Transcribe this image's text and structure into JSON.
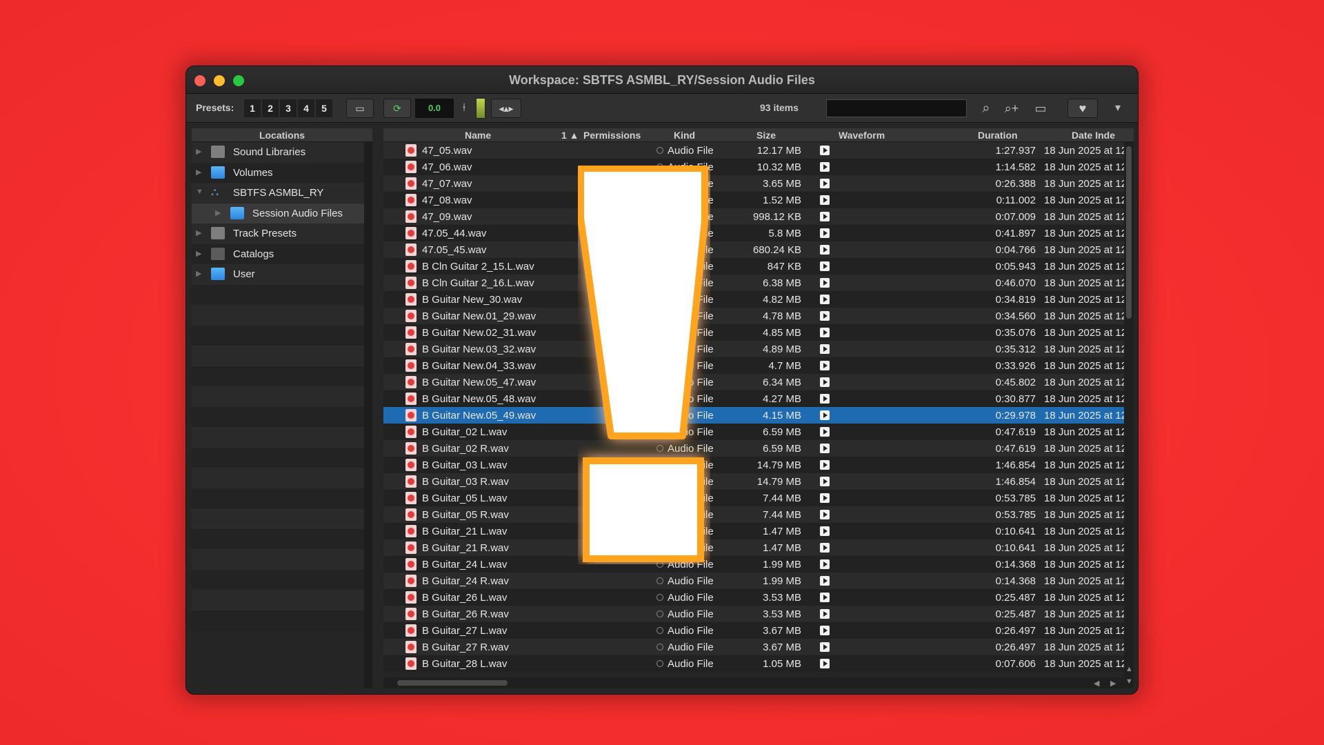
{
  "window": {
    "title": "Workspace: SBTFS ASMBL_RY/Session Audio Files"
  },
  "toolbar": {
    "presets_label": "Presets:",
    "presets": [
      "1",
      "2",
      "3",
      "4",
      "5"
    ],
    "level": "0.0",
    "items_count": "93 items",
    "search_value": ""
  },
  "locations": {
    "header": "Locations",
    "items": [
      {
        "label": "Sound Libraries",
        "icon": "sound-library-icon"
      },
      {
        "label": "Volumes",
        "icon": "folder-icon"
      },
      {
        "label": "SBTFS ASMBL_RY",
        "icon": "network-session-icon"
      },
      {
        "label": "Session Audio Files",
        "icon": "folder-icon"
      },
      {
        "label": "Track Presets",
        "icon": "track-presets-icon"
      },
      {
        "label": "Catalogs",
        "icon": "catalog-icon"
      },
      {
        "label": "User",
        "icon": "folder-icon"
      }
    ]
  },
  "files": {
    "columns": {
      "name": "Name",
      "sort_indicator": "1 ▲",
      "permissions": "Permissions",
      "kind": "Kind",
      "size": "Size",
      "waveform": "Waveform",
      "duration": "Duration",
      "date": "Date Inde"
    },
    "rows": [
      {
        "name": "47_05.wav",
        "kind": "Audio File",
        "size": "12.17 MB",
        "duration": "1:27.937",
        "date": "18 Jun 2025 at 12"
      },
      {
        "name": "47_06.wav",
        "kind": "Audio File",
        "size": "10.32 MB",
        "duration": "1:14.582",
        "date": "18 Jun 2025 at 12"
      },
      {
        "name": "47_07.wav",
        "kind": "Audio File",
        "size": "3.65 MB",
        "duration": "0:26.388",
        "date": "18 Jun 2025 at 12"
      },
      {
        "name": "47_08.wav",
        "kind": "Audio File",
        "size": "1.52 MB",
        "duration": "0:11.002",
        "date": "18 Jun 2025 at 12"
      },
      {
        "name": "47_09.wav",
        "kind": "Audio File",
        "size": "998.12 KB",
        "duration": "0:07.009",
        "date": "18 Jun 2025 at 12"
      },
      {
        "name": "47.05_44.wav",
        "kind": "Audio File",
        "size": "5.8 MB",
        "duration": "0:41.897",
        "date": "18 Jun 2025 at 12"
      },
      {
        "name": "47.05_45.wav",
        "kind": "Audio File",
        "size": "680.24 KB",
        "duration": "0:04.766",
        "date": "18 Jun 2025 at 12"
      },
      {
        "name": "B Cln Guitar 2_15.L.wav",
        "kind": "Audio File",
        "size": "847 KB",
        "duration": "0:05.943",
        "date": "18 Jun 2025 at 12"
      },
      {
        "name": "B Cln Guitar 2_16.L.wav",
        "kind": "Audio File",
        "size": "6.38 MB",
        "duration": "0:46.070",
        "date": "18 Jun 2025 at 12"
      },
      {
        "name": "B Guitar New_30.wav",
        "kind": "Audio File",
        "size": "4.82 MB",
        "duration": "0:34.819",
        "date": "18 Jun 2025 at 12"
      },
      {
        "name": "B Guitar New.01_29.wav",
        "kind": "Audio File",
        "size": "4.78 MB",
        "duration": "0:34.560",
        "date": "18 Jun 2025 at 12"
      },
      {
        "name": "B Guitar New.02_31.wav",
        "kind": "Audio File",
        "size": "4.85 MB",
        "duration": "0:35.076",
        "date": "18 Jun 2025 at 12"
      },
      {
        "name": "B Guitar New.03_32.wav",
        "kind": "Audio File",
        "size": "4.89 MB",
        "duration": "0:35.312",
        "date": "18 Jun 2025 at 12"
      },
      {
        "name": "B Guitar New.04_33.wav",
        "kind": "Audio File",
        "size": "4.7 MB",
        "duration": "0:33.926",
        "date": "18 Jun 2025 at 12"
      },
      {
        "name": "B Guitar New.05_47.wav",
        "kind": "Audio File",
        "size": "6.34 MB",
        "duration": "0:45.802",
        "date": "18 Jun 2025 at 12"
      },
      {
        "name": "B Guitar New.05_48.wav",
        "kind": "Audio File",
        "size": "4.27 MB",
        "duration": "0:30.877",
        "date": "18 Jun 2025 at 12"
      },
      {
        "name": "B Guitar New.05_49.wav",
        "kind": "Audio File",
        "size": "4.15 MB",
        "duration": "0:29.978",
        "date": "18 Jun 2025 at 12",
        "selected": true
      },
      {
        "name": "B Guitar_02 L.wav",
        "kind": "Audio File",
        "size": "6.59 MB",
        "duration": "0:47.619",
        "date": "18 Jun 2025 at 12"
      },
      {
        "name": "B Guitar_02 R.wav",
        "kind": "Audio File",
        "size": "6.59 MB",
        "duration": "0:47.619",
        "date": "18 Jun 2025 at 12"
      },
      {
        "name": "B Guitar_03 L.wav",
        "kind": "Audio File",
        "size": "14.79 MB",
        "duration": "1:46.854",
        "date": "18 Jun 2025 at 12"
      },
      {
        "name": "B Guitar_03 R.wav",
        "kind": "Audio File",
        "size": "14.79 MB",
        "duration": "1:46.854",
        "date": "18 Jun 2025 at 12"
      },
      {
        "name": "B Guitar_05 L.wav",
        "kind": "Audio File",
        "size": "7.44 MB",
        "duration": "0:53.785",
        "date": "18 Jun 2025 at 12"
      },
      {
        "name": "B Guitar_05 R.wav",
        "kind": "Audio File",
        "size": "7.44 MB",
        "duration": "0:53.785",
        "date": "18 Jun 2025 at 12"
      },
      {
        "name": "B Guitar_21 L.wav",
        "kind": "Audio File",
        "size": "1.47 MB",
        "duration": "0:10.641",
        "date": "18 Jun 2025 at 12"
      },
      {
        "name": "B Guitar_21 R.wav",
        "kind": "Audio File",
        "size": "1.47 MB",
        "duration": "0:10.641",
        "date": "18 Jun 2025 at 12"
      },
      {
        "name": "B Guitar_24 L.wav",
        "kind": "Audio File",
        "size": "1.99 MB",
        "duration": "0:14.368",
        "date": "18 Jun 2025 at 12"
      },
      {
        "name": "B Guitar_24 R.wav",
        "kind": "Audio File",
        "size": "1.99 MB",
        "duration": "0:14.368",
        "date": "18 Jun 2025 at 12"
      },
      {
        "name": "B Guitar_26 L.wav",
        "kind": "Audio File",
        "size": "3.53 MB",
        "duration": "0:25.487",
        "date": "18 Jun 2025 at 12"
      },
      {
        "name": "B Guitar_26 R.wav",
        "kind": "Audio File",
        "size": "3.53 MB",
        "duration": "0:25.487",
        "date": "18 Jun 2025 at 12"
      },
      {
        "name": "B Guitar_27 L.wav",
        "kind": "Audio File",
        "size": "3.67 MB",
        "duration": "0:26.497",
        "date": "18 Jun 2025 at 12"
      },
      {
        "name": "B Guitar_27 R.wav",
        "kind": "Audio File",
        "size": "3.67 MB",
        "duration": "0:26.497",
        "date": "18 Jun 2025 at 12"
      },
      {
        "name": "B Guitar_28 L.wav",
        "kind": "Audio File",
        "size": "1.05 MB",
        "duration": "0:07.606",
        "date": "18 Jun 2025 at 12"
      }
    ]
  },
  "overlay": {
    "icon": "exclamation-mark-icon",
    "fill": "#ffffff",
    "outline": "#ffa41c"
  },
  "colors": {
    "background": "#f52e2e",
    "selection": "#1f6bb2"
  }
}
